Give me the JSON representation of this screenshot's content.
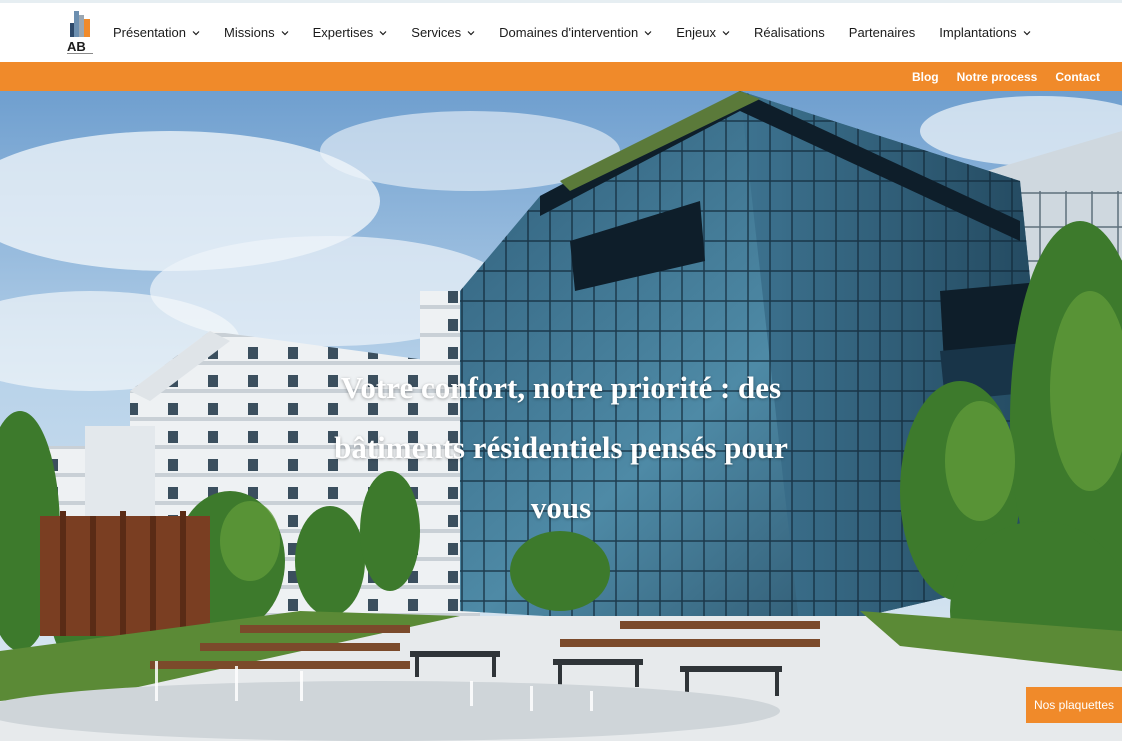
{
  "brand": {
    "logo_text": "AB"
  },
  "nav": {
    "items": [
      {
        "label": "Présentation",
        "dropdown": true
      },
      {
        "label": "Missions",
        "dropdown": true
      },
      {
        "label": "Expertises",
        "dropdown": true
      },
      {
        "label": "Services",
        "dropdown": true
      },
      {
        "label": "Domaines d'intervention",
        "dropdown": true
      },
      {
        "label": "Enjeux",
        "dropdown": true
      },
      {
        "label": "Réalisations",
        "dropdown": false
      },
      {
        "label": "Partenaires",
        "dropdown": false
      },
      {
        "label": "Implantations",
        "dropdown": true
      }
    ]
  },
  "subnav": {
    "blog": "Blog",
    "process": "Notre process",
    "contact": "Contact"
  },
  "hero": {
    "title": "Votre confort, notre priorité : des bâtiments résidentiels pensés pour vous",
    "brochure_button": "Nos plaquettes"
  },
  "colors": {
    "accent": "#f08a2a",
    "text": "#1b1b1b",
    "white": "#ffffff"
  },
  "icons": {
    "dropdown": "chevron-down-icon",
    "logo": "building-logo-icon"
  }
}
